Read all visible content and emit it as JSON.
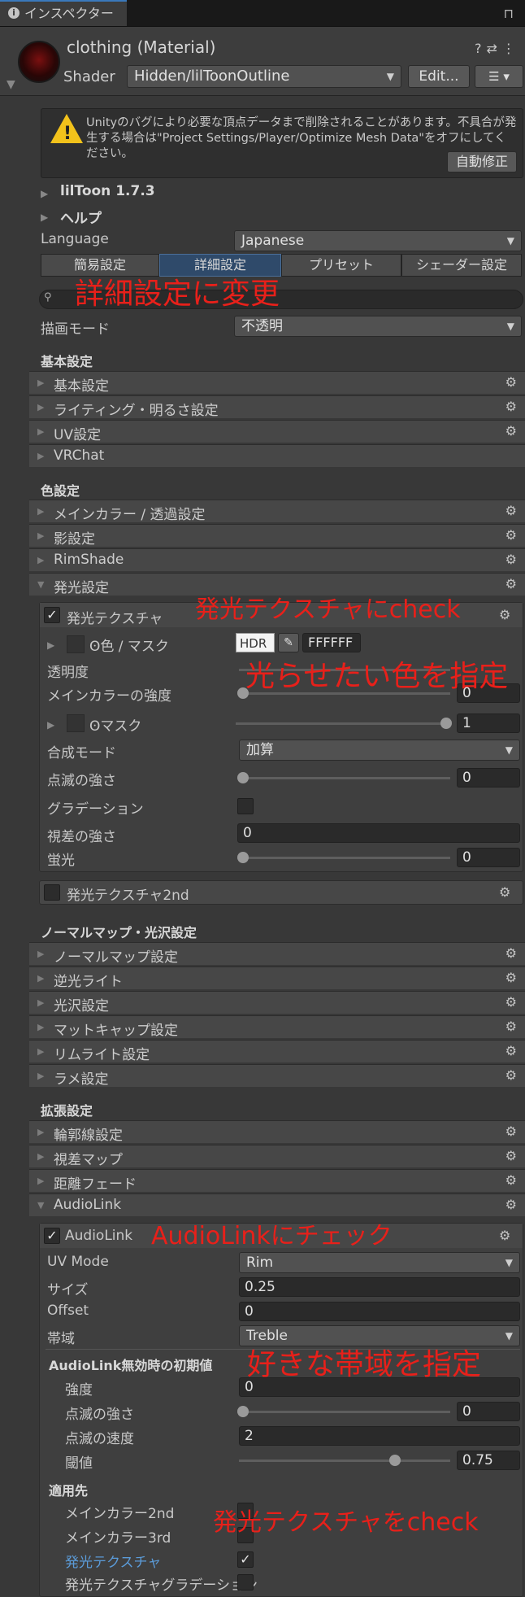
{
  "window": {
    "tab_title": "インスペクター"
  },
  "header": {
    "material_title": "clothing (Material)",
    "shader_label": "Shader",
    "shader_value": "Hidden/lilToonOutline",
    "edit_label": "Edit..."
  },
  "warning": {
    "text": "Unityのバグにより必要な頂点データまで削除されることがあります。不具合が発生する場合は\"Project Settings/Player/Optimize Mesh Data\"をオフにしてください。",
    "fix_label": "自動修正"
  },
  "foldouts": {
    "liltoon": "lilToon 1.7.3",
    "help": "ヘルプ"
  },
  "language": {
    "label": "Language",
    "value": "Japanese"
  },
  "mode_tabs": [
    "簡易設定",
    "詳細設定",
    "プリセット",
    "シェーダー設定"
  ],
  "render_mode": {
    "label": "描画モード",
    "value": "不透明"
  },
  "basic": {
    "header": "基本設定",
    "items": [
      "基本設定",
      "ライティング・明るさ設定",
      "UV設定",
      "VRChat"
    ]
  },
  "color": {
    "header": "色設定",
    "items": [
      "メインカラー / 透過設定",
      "影設定",
      "RimShade",
      "発光設定"
    ]
  },
  "emission": {
    "texture_label": "発光テクスチャ",
    "color_mask_label": "色 / マスク",
    "hdr": "HDR",
    "hex": "FFFFFF",
    "alpha_label": "透明度",
    "main_strength_label": "メインカラーの強度",
    "main_strength_value": "0",
    "mask_label": "マスク",
    "mask_value": "1",
    "blend_label": "合成モード",
    "blend_value": "加算",
    "blink_label": "点滅の強さ",
    "blink_value": "0",
    "gradation_label": "グラデーション",
    "parallax_label": "視差の強さ",
    "parallax_value": "0",
    "fluor_label": "蛍光",
    "fluor_value": "0",
    "texture2_label": "発光テクスチャ2nd"
  },
  "normal": {
    "header": "ノーマルマップ・光沢設定",
    "items": [
      "ノーマルマップ設定",
      "逆光ライト",
      "光沢設定",
      "マットキャップ設定",
      "リムライト設定",
      "ラメ設定"
    ]
  },
  "ext": {
    "header": "拡張設定",
    "items": [
      "輪郭線設定",
      "視差マップ",
      "距離フェード",
      "AudioLink"
    ]
  },
  "audiolink": {
    "toggle_label": "AudioLink",
    "uv_label": "UV Mode",
    "uv_value": "Rim",
    "size_label": "サイズ",
    "size_value": "0.25",
    "offset_label": "Offset",
    "offset_value": "0",
    "band_label": "帯域",
    "band_value": "Treble",
    "default_header": "AudioLink無効時の初期値",
    "strength_label": "強度",
    "strength_value": "0",
    "blink_label": "点滅の強さ",
    "blink_value": "0",
    "speed_label": "点滅の速度",
    "speed_value": "2",
    "threshold_label": "閾値",
    "threshold_value": "0.75",
    "target_header": "適用先",
    "targets": [
      "メインカラー2nd",
      "メインカラー3rd",
      "発光テクスチャ",
      "発光テクスチャグラデーション"
    ]
  },
  "annotations": {
    "a1": "詳細設定に変更",
    "a2": "発光テクスチャにcheck",
    "a3": "光らせたい色を指定",
    "a4": "AudioLinkにチェック",
    "a5": "好きな帯域を指定",
    "a6": "発光テクスチャをcheck"
  },
  "colors": {
    "accent": "#3a79bb",
    "annotation": "#e8201a",
    "warning": "#f2c21b",
    "link": "#5b9bd8"
  }
}
